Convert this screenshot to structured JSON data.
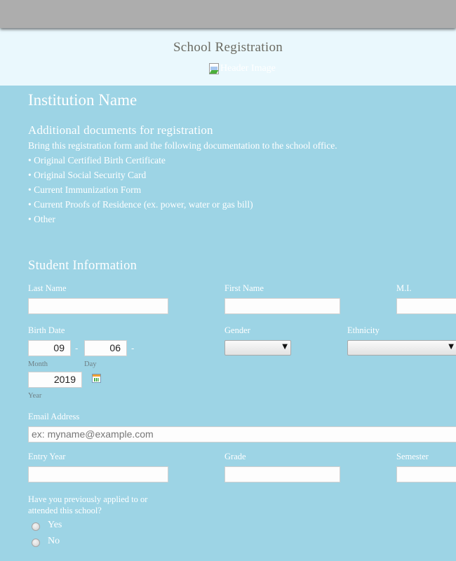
{
  "header": {
    "title": "School Registration",
    "image_alt": "Header Image"
  },
  "intro": {
    "institution_name": "Institution Name",
    "documents_title": "Additional documents for registration",
    "documents_description": "Bring this registration form and the following documentation to the school office.",
    "documents": [
      "• Original Certified Birth Certificate",
      "• Original Social Security Card",
      "• Current Immunization Form",
      "• Current Proofs of Residence (ex. power, water or gas bill)",
      "• Other"
    ]
  },
  "student_section": {
    "title": "Student Information",
    "last_name": {
      "label": "Last Name",
      "value": ""
    },
    "first_name": {
      "label": "First Name",
      "value": ""
    },
    "middle_initial": {
      "label": "M.I.",
      "value": ""
    },
    "birth_date": {
      "label": "Birth Date",
      "month": {
        "value": "09",
        "sublabel": "Month"
      },
      "day": {
        "value": "06",
        "sublabel": "Day"
      },
      "year": {
        "value": "2019",
        "sublabel": "Year"
      },
      "separator": "-",
      "calendar_icon": "calendar-icon"
    },
    "gender": {
      "label": "Gender",
      "selected": ""
    },
    "ethnicity": {
      "label": "Ethnicity",
      "selected": ""
    },
    "email": {
      "label": "Email Address",
      "placeholder": "ex: myname@example.com",
      "value": ""
    },
    "entry_year": {
      "label": "Entry Year",
      "value": ""
    },
    "grade": {
      "label": "Grade",
      "value": ""
    },
    "semester": {
      "label": "Semester",
      "value": ""
    },
    "previously_applied": {
      "question_line1": "Have you previously applied to or",
      "question_line2": "attended this school?",
      "options": [
        "Yes",
        "No"
      ]
    }
  }
}
